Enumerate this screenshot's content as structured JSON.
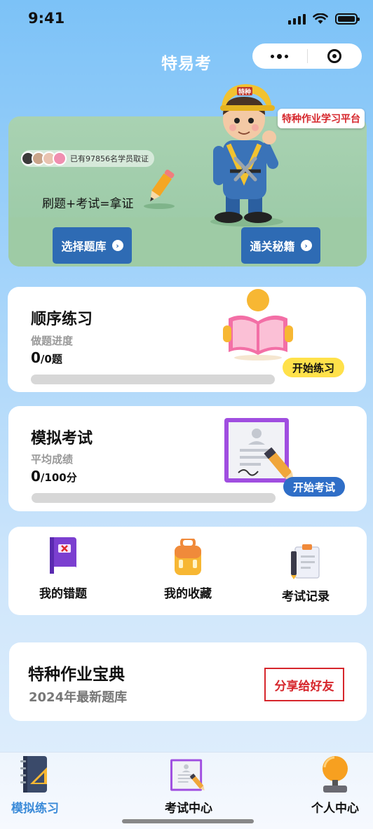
{
  "status_bar": {
    "time": "9:41"
  },
  "header": {
    "title": "特易考"
  },
  "banner": {
    "learners_text": "已有97856名学员取证",
    "slogan": "刷题+考试=拿证",
    "platform_tag": "特种作业学习平台",
    "badge_text": "特种",
    "select_bank_label": "选择题库",
    "tips_label": "通关秘籍"
  },
  "practice": {
    "title": "顺序练习",
    "progress_label": "做题进度",
    "done_count": "0",
    "total_suffix": "/0题",
    "progress_fraction": 0,
    "start_label": "开始练习"
  },
  "exam": {
    "title": "模拟考试",
    "score_label": "平均成绩",
    "avg_score": "0",
    "score_suffix": "/100分",
    "progress_fraction": 0,
    "start_label": "开始考试"
  },
  "quick_links": [
    {
      "label": "我的错题",
      "icon": "wrong-book-icon"
    },
    {
      "label": "我的收藏",
      "icon": "favorites-bag-icon"
    },
    {
      "label": "考试记录",
      "icon": "exam-record-icon"
    }
  ],
  "promo": {
    "title": "特种作业宝典",
    "subtitle": "2024年最新题库",
    "share_label": "分享给好友"
  },
  "tabbar": {
    "items": [
      {
        "label": "模拟练习",
        "active": true
      },
      {
        "label": "考试中心",
        "active": false
      },
      {
        "label": "个人中心",
        "active": false
      }
    ]
  },
  "colors": {
    "accent_blue": "#2e6bb4",
    "active_tab": "#3a8ad8",
    "yellow_pill": "#ffe14a",
    "share_red": "#d6262c"
  }
}
